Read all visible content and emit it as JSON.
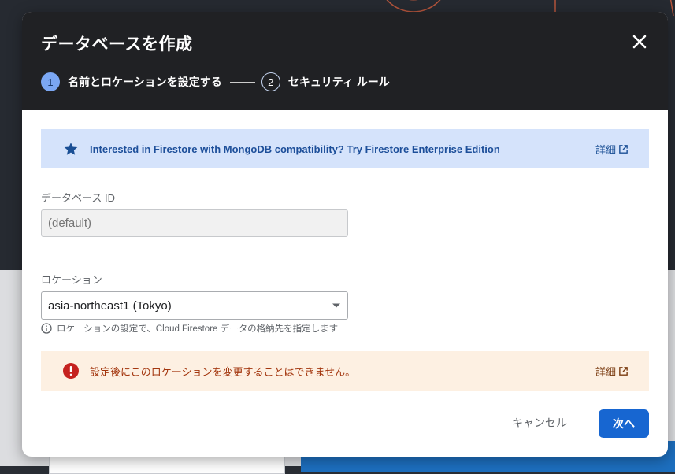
{
  "dialog": {
    "title": "データベースを作成",
    "steps": [
      {
        "number": "1",
        "label": "名前とロケーションを設定する"
      },
      {
        "number": "2",
        "label": "セキュリティ ルール"
      }
    ]
  },
  "info_banner": {
    "text": "Interested in Firestore with MongoDB compatibility? Try Firestore Enterprise Edition",
    "link_label": "詳細",
    "icon": "star-icon"
  },
  "database_id": {
    "label": "データベース ID",
    "placeholder": "(default)"
  },
  "location": {
    "label": "ロケーション",
    "value": "asia-northeast1 (Tokyo)",
    "hint": "ロケーションの設定で、Cloud Firestore データの格納先を指定します"
  },
  "warning_banner": {
    "text": "設定後にこのロケーションを変更することはできません。",
    "link_label": "詳細",
    "icon": "error-icon"
  },
  "footer": {
    "cancel_label": "キャンセル",
    "next_label": "次へ"
  },
  "colors": {
    "header_bg": "#202124",
    "info_banner_bg": "#d5e3fb",
    "warning_banner_bg": "#fdf0e2",
    "primary_button": "#1766d1",
    "error_icon": "#c5221f"
  }
}
